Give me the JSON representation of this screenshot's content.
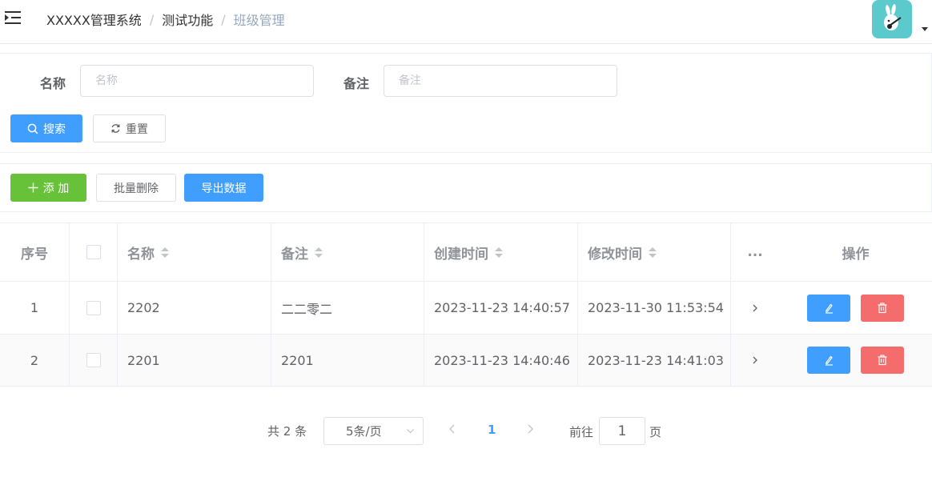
{
  "header": {
    "breadcrumb": [
      "XXXXX管理系统",
      "测试功能",
      "班级管理"
    ],
    "separator": "/"
  },
  "search": {
    "name_label": "名称",
    "name_placeholder": "名称",
    "name_value": "",
    "note_label": "备注",
    "note_placeholder": "备注",
    "note_value": "",
    "search_button": "搜索",
    "reset_button": "重置"
  },
  "toolbar": {
    "add_button": "添 加",
    "batch_delete_button": "批量删除",
    "export_button": "导出数据"
  },
  "table": {
    "columns": {
      "index": "序号",
      "name": "名称",
      "note": "备注",
      "created": "创建时间",
      "modified": "修改时间",
      "more": "...",
      "actions": "操作"
    },
    "rows": [
      {
        "index": "1",
        "name": "2202",
        "note": "二二零二",
        "created": "2023-11-23 14:40:57",
        "modified": "2023-11-30 11:53:54"
      },
      {
        "index": "2",
        "name": "2201",
        "note": "2201",
        "created": "2023-11-23 14:40:46",
        "modified": "2023-11-23 14:41:03"
      }
    ]
  },
  "pagination": {
    "total_text": "共 2 条",
    "page_size": "5条/页",
    "current_page": "1",
    "goto_label": "前往",
    "goto_value": "1",
    "page_unit": "页"
  },
  "colors": {
    "primary": "#409eff",
    "success": "#67c23a",
    "danger": "#f56c6c",
    "avatar_bg": "#5cc9cc"
  }
}
